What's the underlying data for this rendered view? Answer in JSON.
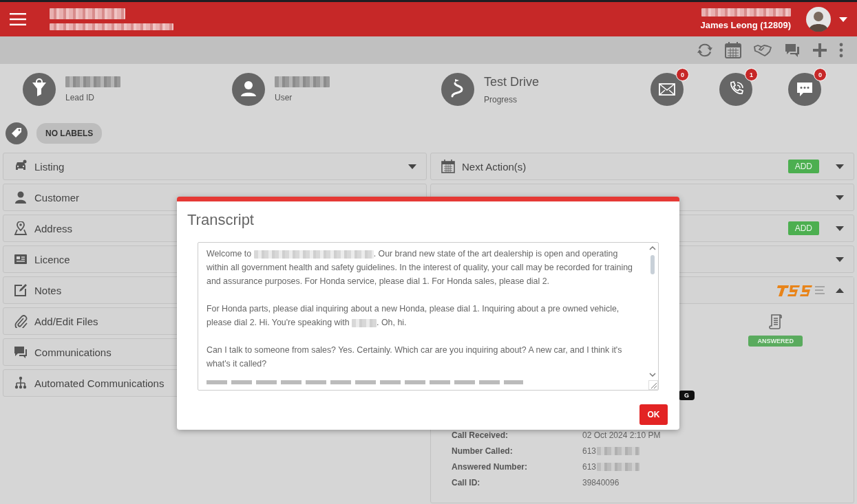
{
  "header": {
    "user_name": "James Leong (12809)"
  },
  "info": [
    {
      "kind": "lead",
      "label": "Lead ID"
    },
    {
      "kind": "user",
      "label": "User"
    },
    {
      "kind": "progress",
      "value": "Test Drive",
      "label": "Progress"
    }
  ],
  "counters": [
    {
      "kind": "email",
      "count": "0"
    },
    {
      "kind": "call",
      "count": "1"
    },
    {
      "kind": "chat",
      "count": "0"
    }
  ],
  "labels_button": "NO LABELS",
  "left_panels": [
    {
      "kind": "car",
      "title": "Listing",
      "expanded": false
    },
    {
      "kind": "person",
      "title": "Customer"
    },
    {
      "kind": "pin",
      "title": "Address"
    },
    {
      "kind": "card",
      "title": "Licence"
    },
    {
      "kind": "note",
      "title": "Notes"
    },
    {
      "kind": "clip",
      "title": "Add/Edit Files"
    },
    {
      "kind": "chat",
      "title": "Communications"
    },
    {
      "kind": "tree",
      "title": "Automated Communications"
    }
  ],
  "right_panels": [
    {
      "kind": "calendar",
      "title": "Next Action(s)",
      "add": "ADD",
      "expanded": false
    },
    {
      "expanded": false
    },
    {
      "add": "ADD",
      "expanded": false
    },
    {
      "expanded": false
    },
    {
      "kind": "tss",
      "expanded": true
    }
  ],
  "call": {
    "status": "ANSWERED",
    "badge": "G",
    "details": [
      {
        "label": "Call Received:",
        "value": "02 Oct 2024 2:10 PM"
      },
      {
        "label": "Number Called:",
        "value": "613",
        "redacted": true
      },
      {
        "label": "Answered Number:",
        "value": "613",
        "redacted": true
      },
      {
        "label": "Call ID:",
        "value": "39840096"
      }
    ]
  },
  "modal": {
    "title": "Transcript",
    "paragraphs": [
      [
        "Welcome to ",
        ". Our brand new state of the art dealership is open and operating within all government health and safety guidelines. In the interest of quality, your call may be recorded for training and assurance purposes. For Honda service, please dial 1. For Honda sales, please dial 2."
      ],
      [
        " For Honda parts, please dial inquiring about a new Honda, please dial 1. Inquiring about a pre owned vehicle, please dial 2. Hi. You're speaking with ",
        ". Oh, hi."
      ],
      [
        " Can I talk to someone from sales? Yes. Certainly. Which car are you inquiring about? A new car, and I think it's what's it called?"
      ]
    ],
    "button": "OK"
  }
}
